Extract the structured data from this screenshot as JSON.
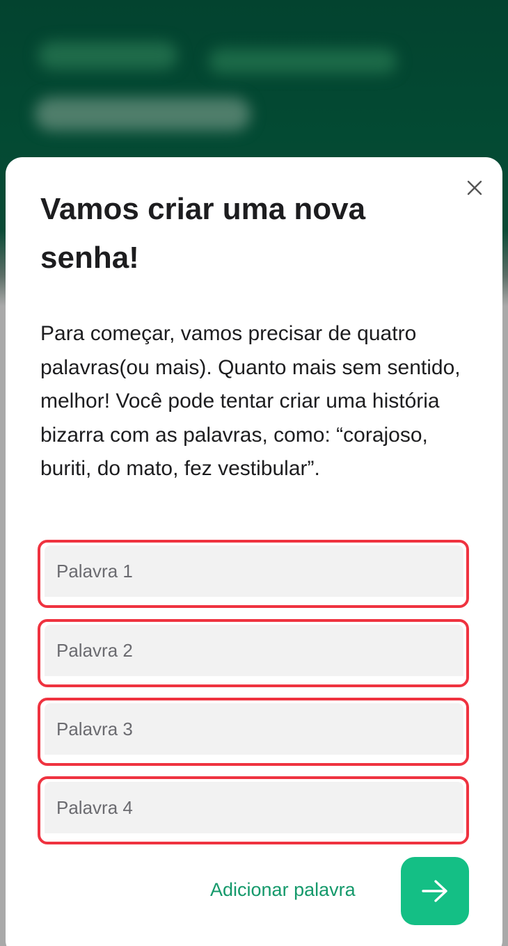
{
  "modal": {
    "title": "Vamos criar uma nova senha!",
    "description": "Para começar, vamos precisar de quatro palavras(ou mais). Quanto mais sem sentido, melhor! Você pode tentar criar uma história bizarra com as palavras, como: “corajoso, buriti, do mato, fez vestibular”.",
    "close_icon": "close-icon",
    "fields": [
      {
        "placeholder": "Palavra 1",
        "value": ""
      },
      {
        "placeholder": "Palavra 2",
        "value": ""
      },
      {
        "placeholder": "Palavra 3",
        "value": ""
      },
      {
        "placeholder": "Palavra 4",
        "value": ""
      }
    ],
    "add_word_label": "Adicionar palavra",
    "next_icon": "arrow-right-icon"
  },
  "colors": {
    "header_green": "#03432f",
    "accent_green": "#14bf85",
    "link_green": "#15996b",
    "error_red": "#ef3340",
    "field_bg": "#f2f2f2"
  }
}
